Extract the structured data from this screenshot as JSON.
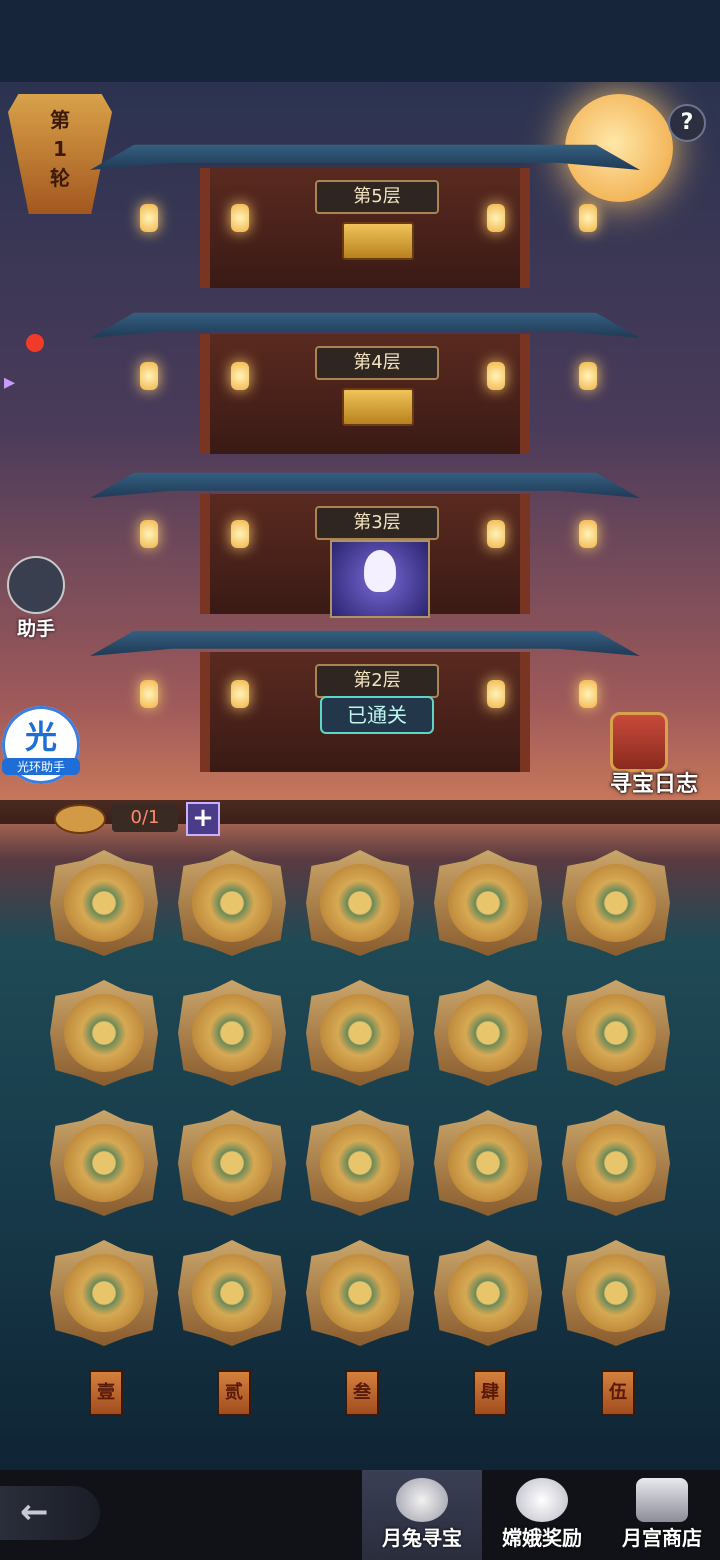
{
  "round": {
    "label": "第\n1\n轮"
  },
  "help": {
    "label": "?"
  },
  "pagoda": {
    "floors": [
      {
        "label": "第5层",
        "content": "chest"
      },
      {
        "label": "第4层",
        "content": "chest"
      },
      {
        "label": "第3层",
        "content": "rabbit"
      },
      {
        "label": "第2层",
        "content": "cleared"
      }
    ],
    "cleared_label": "已通关"
  },
  "side": {
    "assistant_label": "助手",
    "halo_glyph": "光",
    "halo_label": "光环助手"
  },
  "log": {
    "label": "寻宝日志"
  },
  "counter": {
    "value": "0/1",
    "plus": "+"
  },
  "grid": {
    "rows": 4,
    "cols": 5,
    "plaques": [
      "壹",
      "贰",
      "叁",
      "肆",
      "伍"
    ]
  },
  "nav": {
    "back_glyph": "←",
    "tabs": [
      {
        "label": "月兔寻宝",
        "icon": "mooncake-icon",
        "active": true
      },
      {
        "label": "嫦娥奖励",
        "icon": "chang-e-icon",
        "active": false
      },
      {
        "label": "月宫商店",
        "icon": "chest-icon",
        "active": false
      }
    ]
  },
  "colors": {
    "accent": "#f3b65a",
    "cleared": "#5dd6c8",
    "count_text": "#ff8a6a"
  }
}
